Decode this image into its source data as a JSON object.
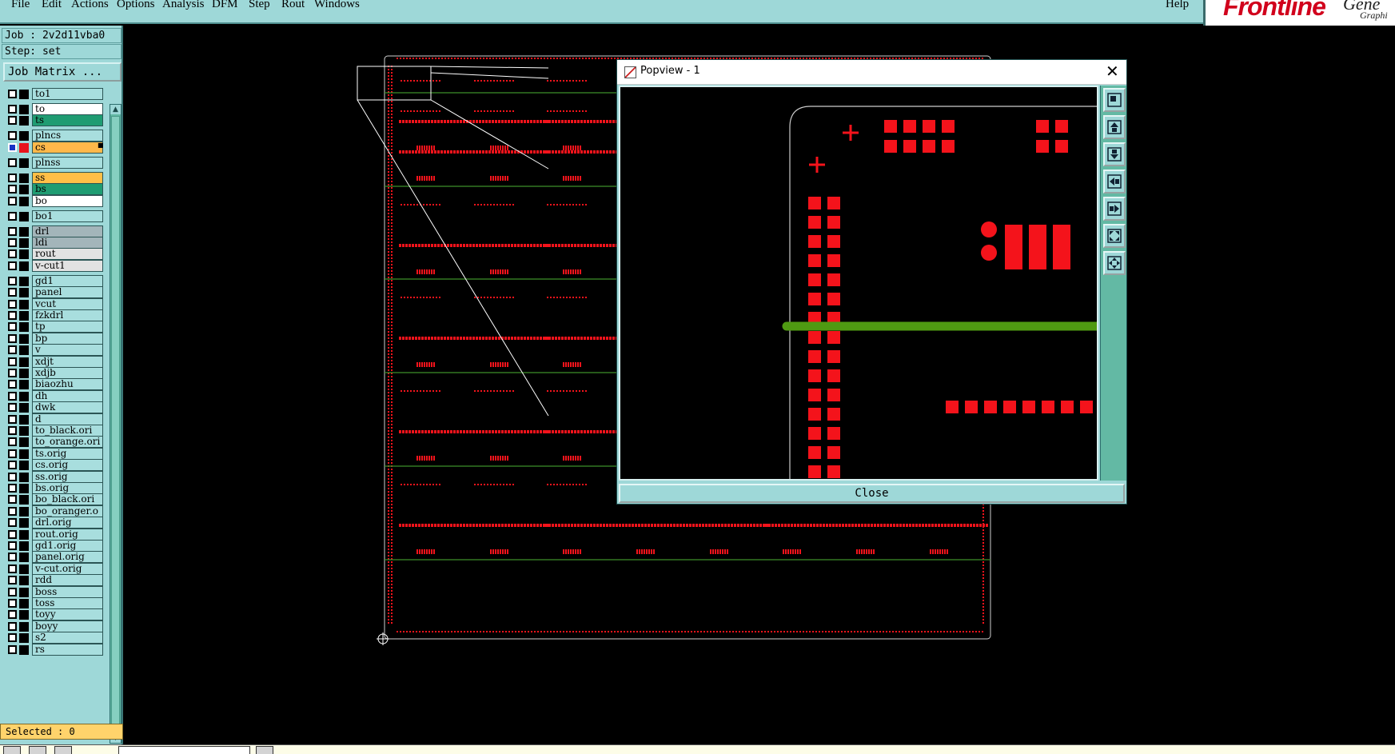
{
  "menubar": {
    "items": [
      "File",
      "Edit",
      "Actions",
      "Options",
      "Analysis",
      "DFM",
      "Step",
      "Rout",
      "Windows"
    ],
    "help": "Help",
    "brand_logo": "Frontline",
    "brand_word": "Gene",
    "brand_sub": "Graphi"
  },
  "job": {
    "job_label": "Job : 2v2d11vba0",
    "step_label": "Step: set",
    "matrix_button": "Job Matrix ..."
  },
  "layers": [
    {
      "name": "to1",
      "color": "#a8dede",
      "swatch": "#000000",
      "checked": false
    },
    {
      "name": "to",
      "color": "#ffffff",
      "swatch": "#000000",
      "checked": false
    },
    {
      "name": "ts",
      "color": "#1f9c72",
      "swatch": "#000000",
      "checked": false
    },
    {
      "name": "plncs",
      "color": "#a8dede",
      "swatch": "#000000",
      "checked": false
    },
    {
      "name": "cs",
      "color": "#ffb84a",
      "swatch": "#e8141b",
      "checked": true,
      "mark": "■"
    },
    {
      "name": "plnss",
      "color": "#a8dede",
      "swatch": "#000000",
      "checked": false
    },
    {
      "name": "ss",
      "color": "#ffbf47",
      "swatch": "#000000",
      "checked": false
    },
    {
      "name": "bs",
      "color": "#1f9c72",
      "swatch": "#000000",
      "checked": false
    },
    {
      "name": "bo",
      "color": "#ffffff",
      "swatch": "#000000",
      "checked": false
    },
    {
      "name": "bo1",
      "color": "#a8dede",
      "swatch": "#000000",
      "checked": false
    },
    {
      "name": "drl",
      "color": "#a3b5ba",
      "swatch": "#000000",
      "checked": false
    },
    {
      "name": "ldi",
      "color": "#a3b5ba",
      "swatch": "#000000",
      "checked": false
    },
    {
      "name": "rout",
      "color": "#e2e2e2",
      "swatch": "#000000",
      "checked": false
    },
    {
      "name": "v-cut1",
      "color": "#e2e2e2",
      "swatch": "#000000",
      "checked": false
    },
    {
      "name": "gd1",
      "color": "#a8dede",
      "swatch": "#000000",
      "checked": false
    },
    {
      "name": "panel",
      "color": "#a8dede",
      "swatch": "#000000",
      "checked": false
    },
    {
      "name": "vcut",
      "color": "#a8dede",
      "swatch": "#000000",
      "checked": false
    },
    {
      "name": "fzkdrl",
      "color": "#a8dede",
      "swatch": "#000000",
      "checked": false
    },
    {
      "name": "tp",
      "color": "#a8dede",
      "swatch": "#000000",
      "checked": false
    },
    {
      "name": "bp",
      "color": "#a8dede",
      "swatch": "#000000",
      "checked": false
    },
    {
      "name": "v",
      "color": "#a8dede",
      "swatch": "#000000",
      "checked": false
    },
    {
      "name": "xdjt",
      "color": "#a8dede",
      "swatch": "#000000",
      "checked": false
    },
    {
      "name": "xdjb",
      "color": "#a8dede",
      "swatch": "#000000",
      "checked": false
    },
    {
      "name": "biaozhu",
      "color": "#a8dede",
      "swatch": "#000000",
      "checked": false
    },
    {
      "name": "dh",
      "color": "#a8dede",
      "swatch": "#000000",
      "checked": false
    },
    {
      "name": "dwk",
      "color": "#a8dede",
      "swatch": "#000000",
      "checked": false
    },
    {
      "name": "d",
      "color": "#a8dede",
      "swatch": "#000000",
      "checked": false
    },
    {
      "name": "to_black.ori",
      "color": "#a8dede",
      "swatch": "#000000",
      "checked": false
    },
    {
      "name": "to_orange.ori",
      "color": "#a8dede",
      "swatch": "#000000",
      "checked": false
    },
    {
      "name": "ts.orig",
      "color": "#a8dede",
      "swatch": "#000000",
      "checked": false
    },
    {
      "name": "cs.orig",
      "color": "#a8dede",
      "swatch": "#000000",
      "checked": false
    },
    {
      "name": "ss.orig",
      "color": "#a8dede",
      "swatch": "#000000",
      "checked": false
    },
    {
      "name": "bs.orig",
      "color": "#a8dede",
      "swatch": "#000000",
      "checked": false
    },
    {
      "name": "bo_black.ori",
      "color": "#a8dede",
      "swatch": "#000000",
      "checked": false
    },
    {
      "name": "bo_oranger.o",
      "color": "#a8dede",
      "swatch": "#000000",
      "checked": false
    },
    {
      "name": "drl.orig",
      "color": "#a8dede",
      "swatch": "#000000",
      "checked": false
    },
    {
      "name": "rout.orig",
      "color": "#a8dede",
      "swatch": "#000000",
      "checked": false
    },
    {
      "name": "gd1.orig",
      "color": "#a8dede",
      "swatch": "#000000",
      "checked": false
    },
    {
      "name": "panel.orig",
      "color": "#a8dede",
      "swatch": "#000000",
      "checked": false
    },
    {
      "name": "v-cut.orig",
      "color": "#a8dede",
      "swatch": "#000000",
      "checked": false
    },
    {
      "name": "rdd",
      "color": "#a8dede",
      "swatch": "#000000",
      "checked": false
    },
    {
      "name": "boss",
      "color": "#a8dede",
      "swatch": "#000000",
      "checked": false
    },
    {
      "name": "toss",
      "color": "#a8dede",
      "swatch": "#000000",
      "checked": false
    },
    {
      "name": "toyy",
      "color": "#a8dede",
      "swatch": "#000000",
      "checked": false
    },
    {
      "name": "boyy",
      "color": "#a8dede",
      "swatch": "#000000",
      "checked": false
    },
    {
      "name": "s2",
      "color": "#a8dede",
      "swatch": "#000000",
      "checked": false
    },
    {
      "name": "rs",
      "color": "#a8dede",
      "swatch": "#000000",
      "checked": false
    }
  ],
  "status": {
    "selected": "Selected : 0"
  },
  "popview": {
    "title": "Popview - 1",
    "close_button": "Close",
    "tools": [
      "zoom-window-icon",
      "zoom-in-icon",
      "zoom-out-icon",
      "pan-left-icon",
      "pan-right-icon",
      "zoom-fit-icon",
      "pan-center-icon"
    ]
  },
  "colors": {
    "ui_teal": "#9ed8d8",
    "pad_red": "#f4131b",
    "outline_green": "#3e8f2a",
    "profile_gray": "#cfcfcf"
  }
}
